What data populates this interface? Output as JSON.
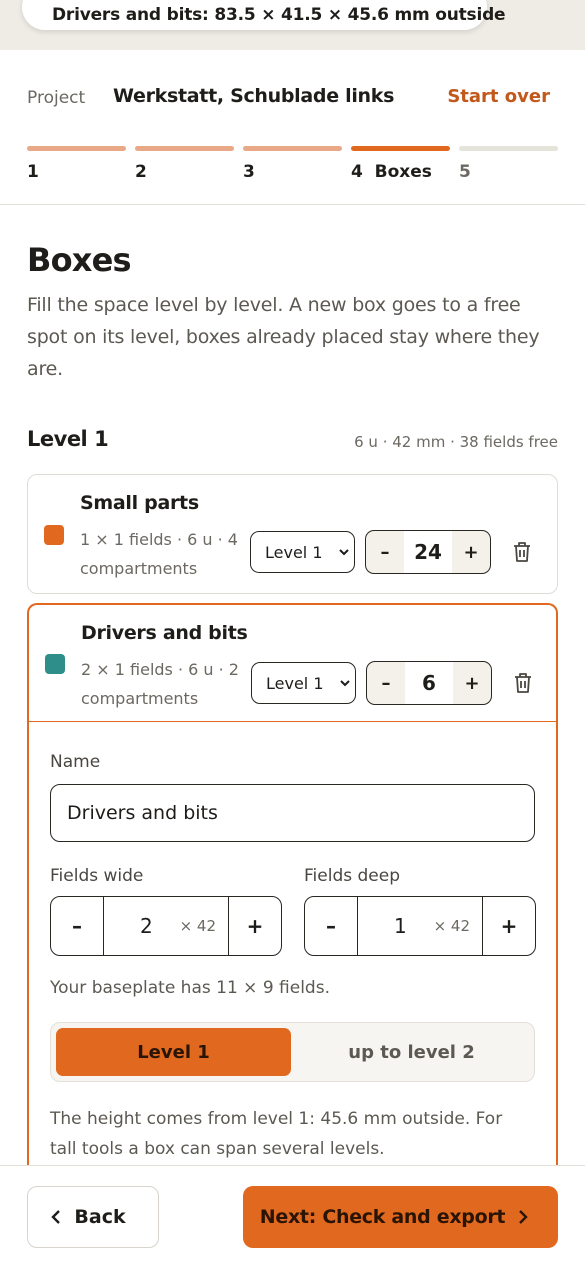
{
  "tooltip": {
    "text": "Drivers and bits: 83.5 × 41.5 × 45.6 mm outside",
    "dot_color": "#2e8e8a"
  },
  "header": {
    "project_label": "Project",
    "project_name": "Werkstatt, Schublade links",
    "start_over": "Start over"
  },
  "steps": [
    {
      "label": "1",
      "color": "#e9a886"
    },
    {
      "label": "2",
      "color": "#e9a886"
    },
    {
      "label": "3",
      "color": "#e9a886"
    },
    {
      "label": "4  Boxes",
      "color": "#e0691f"
    },
    {
      "label": "5",
      "color": "#e4e4da"
    }
  ],
  "page": {
    "title": "Boxes",
    "intro": "Fill the space level by level. A new box goes to a free spot on its level, boxes already placed stay where they are."
  },
  "level": {
    "title": "Level 1",
    "meta": "6 u · 42 mm · 38 fields free"
  },
  "boxes": [
    {
      "name": "Small parts",
      "color": "#e0691f",
      "desc": "1 × 1 fields · 6 u · 4 compartments",
      "level": "Level 1",
      "count": "24"
    },
    {
      "name": "Drivers and bits",
      "color": "#2e8e8a",
      "desc": "2 × 1 fields · 6 u · 2 compartments",
      "level": "Level 1",
      "count": "6"
    }
  ],
  "stepper_labels": {
    "minus": "–",
    "plus": "+"
  },
  "editor": {
    "name_label": "Name",
    "name_value": "Drivers and bits",
    "wide_label": "Fields wide",
    "wide_value": "2",
    "deep_label": "Fields deep",
    "deep_value": "1",
    "unit": "× 42",
    "hint": "Your baseplate has 11 × 9 fields.",
    "toggle_on": "Level 1",
    "toggle_off": "up to level 2",
    "note": "The height comes from level 1: 45.6 mm outside. For tall tools a box can span several levels."
  },
  "footer": {
    "back": "Back",
    "next": "Next: Check and export"
  },
  "icons": {
    "trash": "trash-icon",
    "chevron_left": "chevron-left-icon",
    "chevron_right": "chevron-right-icon",
    "chevron_down": "chevron-down-icon"
  }
}
